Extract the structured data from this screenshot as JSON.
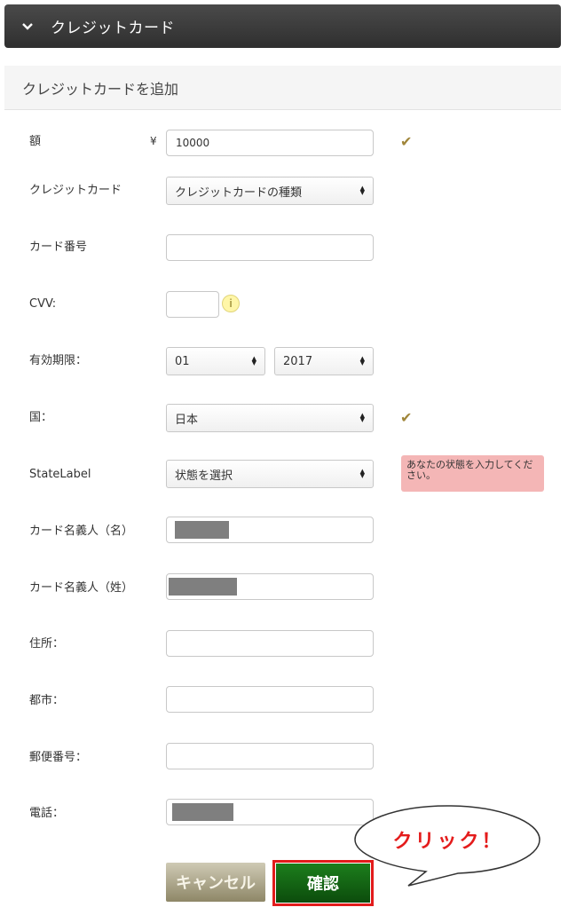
{
  "header": {
    "title": "クレジットカード",
    "chevron_icon": "chevron-down-icon"
  },
  "section": {
    "title": "クレジットカードを追加"
  },
  "form": {
    "amount": {
      "label": "額",
      "currency": "¥",
      "value": "10000"
    },
    "card_type": {
      "label": "クレジットカード",
      "value": "クレジットカードの種類"
    },
    "card_number": {
      "label": "カード番号",
      "value": ""
    },
    "cvv": {
      "label": "CVV:",
      "value": "",
      "info_glyph": "i"
    },
    "expiry": {
      "label": "有効期限：",
      "month": "01",
      "year": "2017"
    },
    "country": {
      "label": "国：",
      "value": "日本"
    },
    "state": {
      "label": "StateLabel",
      "value": "状態を選択",
      "tooltip": "あなたの状態を入力してください。"
    },
    "first_name": {
      "label": "カード名義人（名）"
    },
    "last_name": {
      "label": "カード名義人（姓）"
    },
    "address": {
      "label": "住所：",
      "value": ""
    },
    "city": {
      "label": "都市：",
      "value": ""
    },
    "postal": {
      "label": "郵便番号：",
      "value": ""
    },
    "phone": {
      "label": "電話："
    }
  },
  "buttons": {
    "cancel": "キャンセル",
    "confirm": "確認"
  },
  "annotation": {
    "callout": "クリック！"
  },
  "colors": {
    "check": "#a0863a",
    "confirm": "#1c7e1c",
    "highlight": "#e21b1b",
    "tooltip": "#f4b6b6"
  }
}
